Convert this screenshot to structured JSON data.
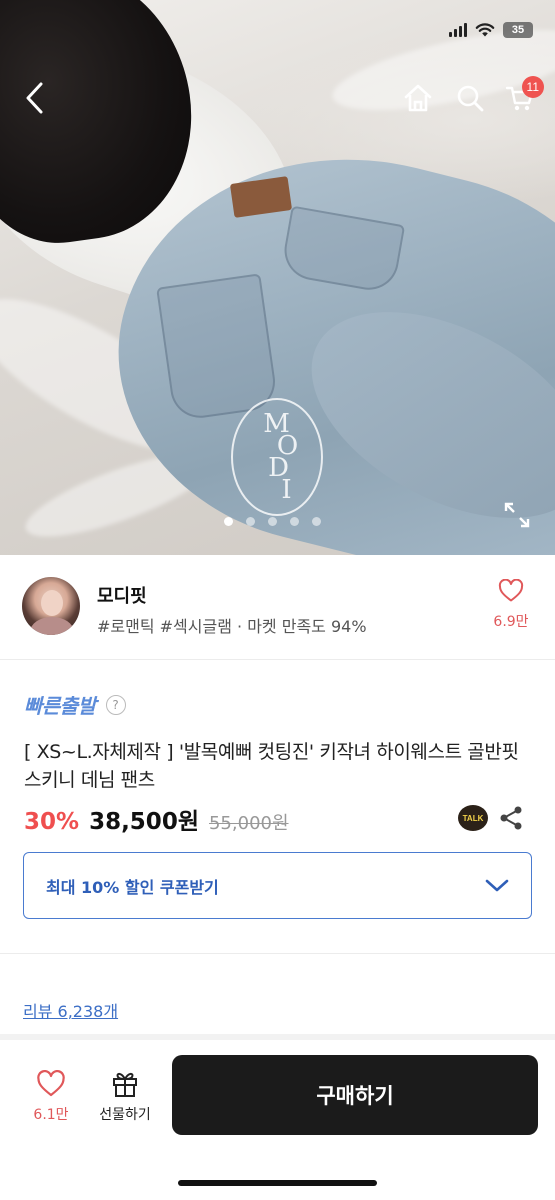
{
  "status_bar": {
    "battery": "35"
  },
  "nav": {
    "cart_count": "11"
  },
  "hero": {
    "watermark_letters": [
      "M",
      "O",
      "D",
      "I"
    ],
    "page_count": 5,
    "active_page": 0
  },
  "seller": {
    "name": "모디핏",
    "tags": "#로맨틱 #섹시글램 · 마켓 만족도 94%",
    "like_count": "6.9만"
  },
  "product": {
    "fast_shipping_label": "빠른출발",
    "help_glyph": "?",
    "title": "[ XS~L.자체제작 ] '발목예뻐 컷팅진' 키작녀 하이웨스트 골반핏 스키니 데님 팬츠",
    "discount": "30%",
    "price": "38,500원",
    "original_price": "55,000원",
    "talk_label": "TALK"
  },
  "coupon": {
    "label": "최대 10% 할인 쿠폰받기"
  },
  "review": {
    "label": "리뷰 6,238개"
  },
  "bottom_bar": {
    "like_count": "6.1만",
    "gift_label": "선물하기",
    "buy_label": "구매하기"
  },
  "colors": {
    "accent_blue": "#4a7bd0",
    "discount_red": "#ef4f4f",
    "heart_red": "#e0585a",
    "buy_button": "#1b1b1b"
  }
}
